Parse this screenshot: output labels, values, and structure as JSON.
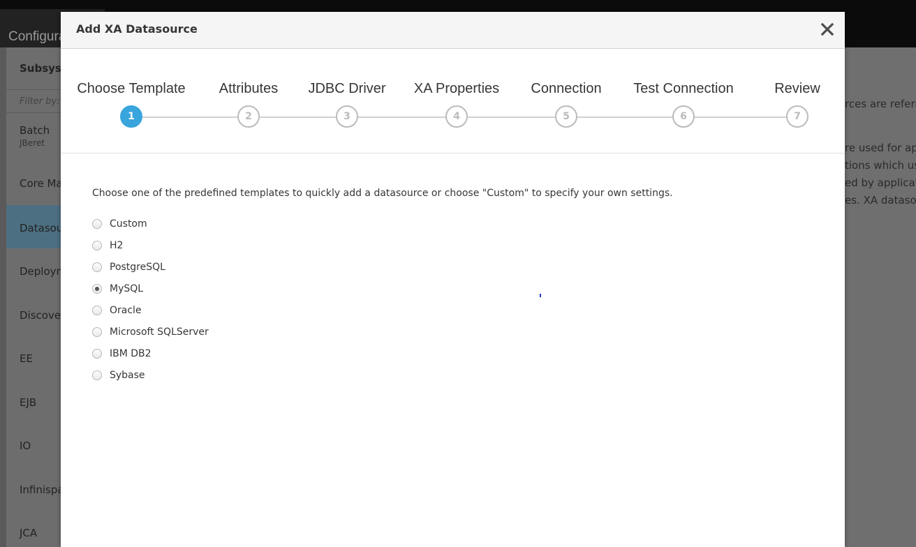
{
  "background": {
    "nav_label": "Configura",
    "sidebar": {
      "title": "Subsyst",
      "filter_placeholder": "Filter by:",
      "items": [
        {
          "label": "Batch",
          "sublabel": "JBeret"
        },
        {
          "label": "Core Ma"
        },
        {
          "label": "Datasou"
        },
        {
          "label": "Deploym"
        },
        {
          "label": "Discover"
        },
        {
          "label": "EE"
        },
        {
          "label": "EJB"
        },
        {
          "label": "IO"
        },
        {
          "label": "Infinispa"
        },
        {
          "label": "JCA"
        }
      ]
    },
    "right_text": [
      "rces are referre",
      "re used for app",
      "tions which use",
      "ed by applicatio",
      "es. XA datasou"
    ]
  },
  "modal": {
    "title": "Add XA Datasource",
    "close_icon": "close-icon",
    "steps": [
      {
        "label": "Choose Template",
        "number": "1",
        "current": true
      },
      {
        "label": "Attributes",
        "number": "2"
      },
      {
        "label": "JDBC Driver",
        "number": "3"
      },
      {
        "label": "XA Properties",
        "number": "4"
      },
      {
        "label": "Connection",
        "number": "5"
      },
      {
        "label": "Test Connection",
        "number": "6"
      },
      {
        "label": "Review",
        "number": "7"
      }
    ],
    "intro": "Choose one of the predefined templates to quickly add a datasource or choose \"Custom\" to specify your own settings.",
    "templates": [
      "Custom",
      "H2",
      "PostgreSQL",
      "MySQL",
      "Oracle",
      "Microsoft SQLServer",
      "IBM DB2",
      "Sybase"
    ],
    "selected_template": "MySQL",
    "colors": {
      "accent": "#39a5dc",
      "step_inactive": "#bbbbbb"
    }
  }
}
